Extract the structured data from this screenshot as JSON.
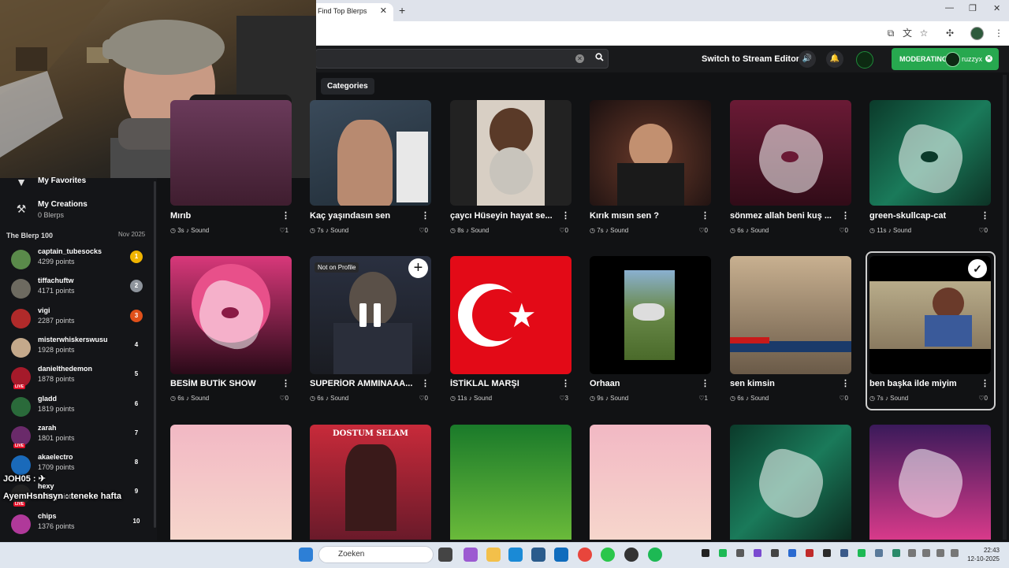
{
  "browser": {
    "tab_title": "Find Top Blerps",
    "tab_close": "✕",
    "new_tab": "+",
    "win_min": "—",
    "win_max": "❐",
    "win_close": "✕"
  },
  "header": {
    "stream_editor": "Switch to Stream Editor",
    "moderating_label": "MODERATING",
    "moderating_user": "ruzzyx",
    "categories": "Categories"
  },
  "sidebar": {
    "favorites": "My Favorites",
    "creations": "My Creations",
    "creations_count": "0 Blerps",
    "leaderboard_title": "The Blerp 100",
    "leaderboard_date": "Nov 2025",
    "leaderboard": [
      {
        "name": "captain_tubesocks",
        "points": "4299 points",
        "rank": "1",
        "rank_color": "#f0b400",
        "avatar": "#5a8a4a"
      },
      {
        "name": "tiffachuftw",
        "points": "4171 points",
        "rank": "2",
        "rank_color": "#8e949c",
        "avatar": "#6d6a60"
      },
      {
        "name": "vigi",
        "points": "2287 points",
        "rank": "3",
        "rank_color": "#e0501a",
        "avatar": "#b02a2a"
      },
      {
        "name": "misterwhiskerswusu",
        "points": "1928 points",
        "rank": "4",
        "rank_color": "transparent",
        "avatar": "#c4a98b"
      },
      {
        "name": "danielthedemon",
        "points": "1878 points",
        "rank": "5",
        "rank_color": "transparent",
        "avatar": "#a51a2a"
      },
      {
        "name": "gladd",
        "points": "1819 points",
        "rank": "6",
        "rank_color": "transparent",
        "avatar": "#2a6a3a"
      },
      {
        "name": "zarah",
        "points": "1801 points",
        "rank": "7",
        "rank_color": "transparent",
        "avatar": "#6a2a6a"
      },
      {
        "name": "akaelectro",
        "points": "1709 points",
        "rank": "8",
        "rank_color": "transparent",
        "avatar": "#1a6aba"
      },
      {
        "name": "hexy",
        "points": "1688 points",
        "rank": "9",
        "rank_color": "transparent",
        "avatar": "#222222"
      },
      {
        "name": "chips",
        "points": "1376 points",
        "rank": "10",
        "rank_color": "transparent",
        "avatar": "#b0399a"
      }
    ],
    "live_label": "LIVE"
  },
  "chat": [
    {
      "text": "JOH05 : ✈"
    },
    {
      "text": "AyemHsnhsyn : teneke hafta"
    }
  ],
  "cards": [
    {
      "title": "Mırıb",
      "duration": "3s",
      "tag": "Sound",
      "likes": "1"
    },
    {
      "title": "Kaç yaşındasın sen",
      "duration": "7s",
      "tag": "Sound",
      "likes": "0"
    },
    {
      "title": "çaycı Hüseyin hayat se...",
      "duration": "8s",
      "tag": "Sound",
      "likes": "0"
    },
    {
      "title": "Kırık mısın sen ?",
      "duration": "7s",
      "tag": "Sound",
      "likes": "0"
    },
    {
      "title": "sönmez allah beni kuş ...",
      "duration": "6s",
      "tag": "Sound",
      "likes": "0"
    },
    {
      "title": "green-skullcap-cat",
      "duration": "11s",
      "tag": "Sound",
      "likes": "0"
    },
    {
      "title": "BESİM BUTİK SHOW",
      "duration": "6s",
      "tag": "Sound",
      "likes": "0"
    },
    {
      "title": "SUPERİOR AMMINAAA...",
      "duration": "6s",
      "tag": "Sound",
      "likes": "0"
    },
    {
      "title": "İSTİKLAL MARŞI",
      "duration": "11s",
      "tag": "Sound",
      "likes": "3"
    },
    {
      "title": "Orhaan",
      "duration": "9s",
      "tag": "Sound",
      "likes": "1"
    },
    {
      "title": "sen kimsin",
      "duration": "6s",
      "tag": "Sound",
      "likes": "0"
    },
    {
      "title": "ben başka ilde miyim",
      "duration": "7s",
      "tag": "Sound",
      "likes": "0"
    }
  ],
  "card_badges": {
    "not_on_profile": "Not on Profile",
    "add": "+",
    "selected": "✓"
  },
  "thumb_texts": {
    "dostum_selam": "DOSTUM SELAM"
  },
  "taskbar": {
    "search_placeholder": "Zoeken",
    "time": "22:43",
    "date": "12-10-2025"
  }
}
